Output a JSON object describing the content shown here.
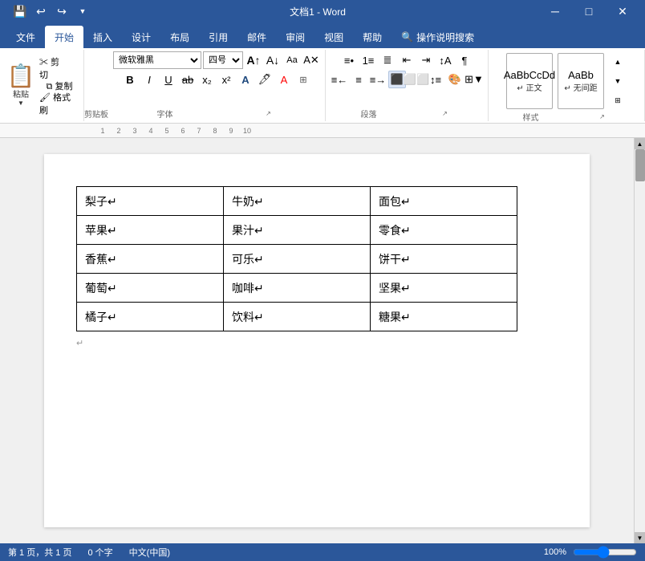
{
  "titleBar": {
    "title": "文档1 - Word",
    "quickAccess": [
      "save",
      "undo",
      "redo"
    ],
    "windowControls": [
      "minimize",
      "restore",
      "close"
    ]
  },
  "tabs": [
    {
      "label": "文件",
      "active": false
    },
    {
      "label": "开始",
      "active": true
    },
    {
      "label": "插入",
      "active": false
    },
    {
      "label": "设计",
      "active": false
    },
    {
      "label": "布局",
      "active": false
    },
    {
      "label": "引用",
      "active": false
    },
    {
      "label": "邮件",
      "active": false
    },
    {
      "label": "审阅",
      "active": false
    },
    {
      "label": "视图",
      "active": false
    },
    {
      "label": "帮助",
      "active": false
    },
    {
      "label": "操作说明搜索",
      "active": false
    }
  ],
  "ribbon": {
    "groups": [
      {
        "name": "剪贴板",
        "paste_label": "粘贴",
        "cut_label": "剪切",
        "copy_label": "复制",
        "format_label": "格式刷"
      },
      {
        "name": "字体",
        "font_name": "微软雅黑",
        "font_size": "四号",
        "bold": "B",
        "italic": "I",
        "underline": "U"
      },
      {
        "name": "段落"
      },
      {
        "name": "样式",
        "styles": [
          {
            "label": "正文",
            "preview": "AaBbCcDd"
          },
          {
            "label": "无间距",
            "preview": "AaBb"
          }
        ]
      }
    ]
  },
  "document": {
    "table": {
      "rows": [
        [
          "梨子↵",
          "牛奶↵",
          "面包↵"
        ],
        [
          "苹果↵",
          "果汁↵",
          "零食↵"
        ],
        [
          "香蕉↵",
          "可乐↵",
          "饼干↵"
        ],
        [
          "葡萄↵",
          "咖啡↵",
          "坚果↵"
        ],
        [
          "橘子↵",
          "饮料↵",
          "糖果↵"
        ]
      ]
    },
    "paragraph_mark": "↵"
  },
  "statusBar": {
    "pageInfo": "第 1 页，共 1 页",
    "wordCount": "0 个字",
    "language": "中文(中国)",
    "zoom": "100%"
  }
}
